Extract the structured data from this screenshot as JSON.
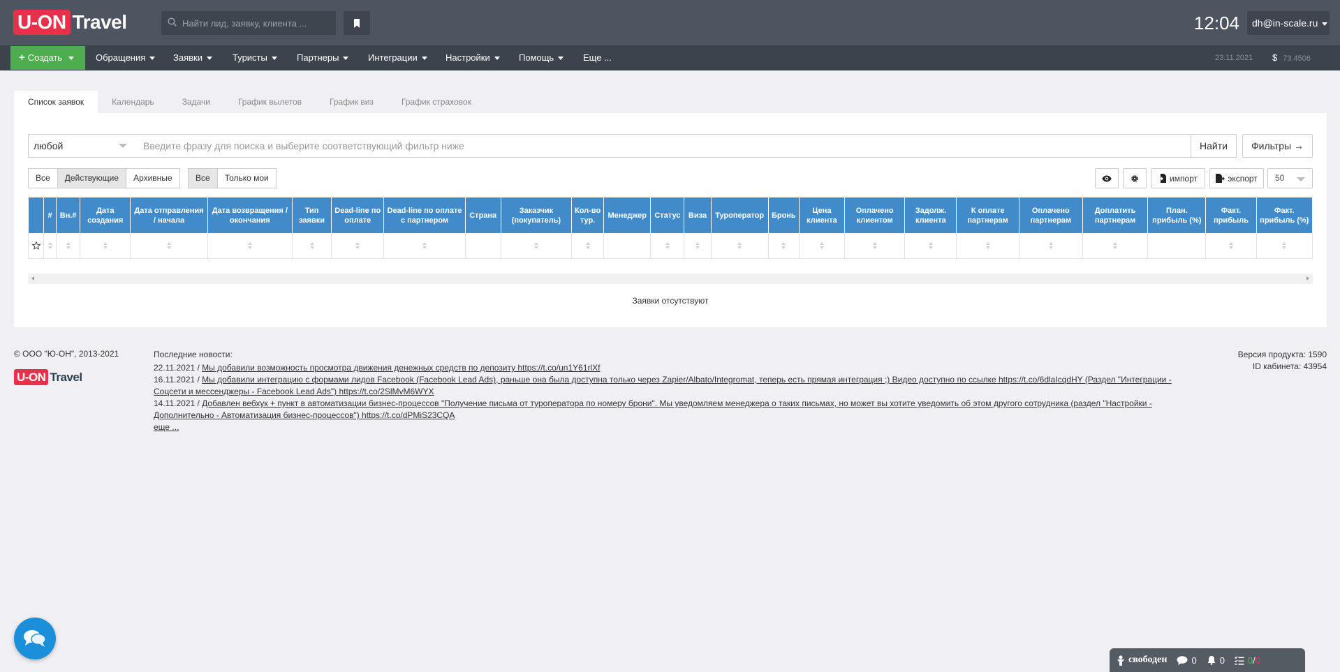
{
  "header": {
    "logo_uon": "U-ON",
    "logo_travel": "Travel",
    "search_placeholder": "Найти лид, заявку, клиента ...",
    "clock": "12:04",
    "user_email": "dh@in-scale.ru"
  },
  "nav": {
    "create_label": "Создать",
    "items": [
      "Обращения",
      "Заявки",
      "Туристы",
      "Партнеры",
      "Интеграции",
      "Настройки",
      "Помощь"
    ],
    "more_label": "Еще ...",
    "date": "23.11.2021",
    "currency_symbol": "$",
    "rate": "73.4506"
  },
  "tabs": [
    "Список заявок",
    "Календарь",
    "Задачи",
    "График вылетов",
    "График виз",
    "График страховок"
  ],
  "search": {
    "type_value": "любой",
    "phrase_placeholder": "Введите фразу для поиска и выберите соответствующий фильтр ниже",
    "find_label": "Найти",
    "filters_label": "Фильтры →"
  },
  "status_filter": [
    "Все",
    "Действующие",
    "Архивные"
  ],
  "owner_filter": [
    "Все",
    "Только мои"
  ],
  "toolbar": {
    "import_label": "импорт",
    "export_label": "экспорт",
    "page_size": "50"
  },
  "table": {
    "columns": [
      "",
      "#",
      "Вн.#",
      "Дата создания",
      "Дата отправления / начала",
      "Дата возвращения / окончания",
      "Тип заявки",
      "Dead-line по оплате",
      "Dead-line по оплате с партнером",
      "Страна",
      "Заказчик (покупатель)",
      "Кол-во тур.",
      "Менеджер",
      "Статус",
      "Виза",
      "Туроператор",
      "Бронь",
      "Цена клиента",
      "Оплачено клиентом",
      "Задолж. клиента",
      "К оплате партнерам",
      "Оплачено партнерам",
      "Доплатить партнерам",
      "План. прибыль (%)",
      "Факт. прибыль",
      "Факт. прибыль (%)"
    ],
    "empty_message": "Заявки отсутствуют"
  },
  "footer": {
    "copyright": "© ООО \"Ю-ОН\", 2013-2021",
    "news_title": "Последние новости:",
    "news": [
      {
        "date": "22.11.2021 / ",
        "text": "Мы добавили возможность просмотра движения денежных средств по депозиту https://t.co/un1Y61rlXf"
      },
      {
        "date": "16.11.2021 / ",
        "text": "Мы добавили интеграцию с формами лидов Facebook (Facebook Lead Ads), раньше она была доступна только через Zapier/Albato/Integromat, теперь есть прямая интеграция ;) Видео доступно по ссылке https://t.co/6dlaIcqdHY (Раздел \"Интеграции - Соцсети и мессенджеры - Facebook Lead Ads\") https://t.co/2SlMvM6WYX"
      },
      {
        "date": "14.11.2021 / ",
        "text": "Добавлен вебхук + пункт в автоматизации бизнес-процессов \"Получение письма от туроператора по номеру брони\". Мы уведомляем менеджера о таких письмах, но может вы хотите уведомить об этом другого сотрудника (раздел \"Настройки - Дополнительно - Автоматизация бизнес-процессов\") https://t.co/dPMiS23CQA"
      }
    ],
    "more_label": "еще ...",
    "version": "Версия продукта: 1590",
    "cabinet_id": "ID кабинета: 43954"
  },
  "status_bar": {
    "state": "свободен",
    "messages": "0",
    "notifications": "0",
    "tasks_done": "0",
    "tasks_sep": " / ",
    "tasks_overdue": "0"
  },
  "colors": {
    "header_bg": "#4d5560",
    "nav_bg": "#3b434c",
    "create_green": "#4cae4c",
    "logo_red": "#e9304b",
    "table_header": "#428bca",
    "chat_blue": "#1b8fd9"
  }
}
